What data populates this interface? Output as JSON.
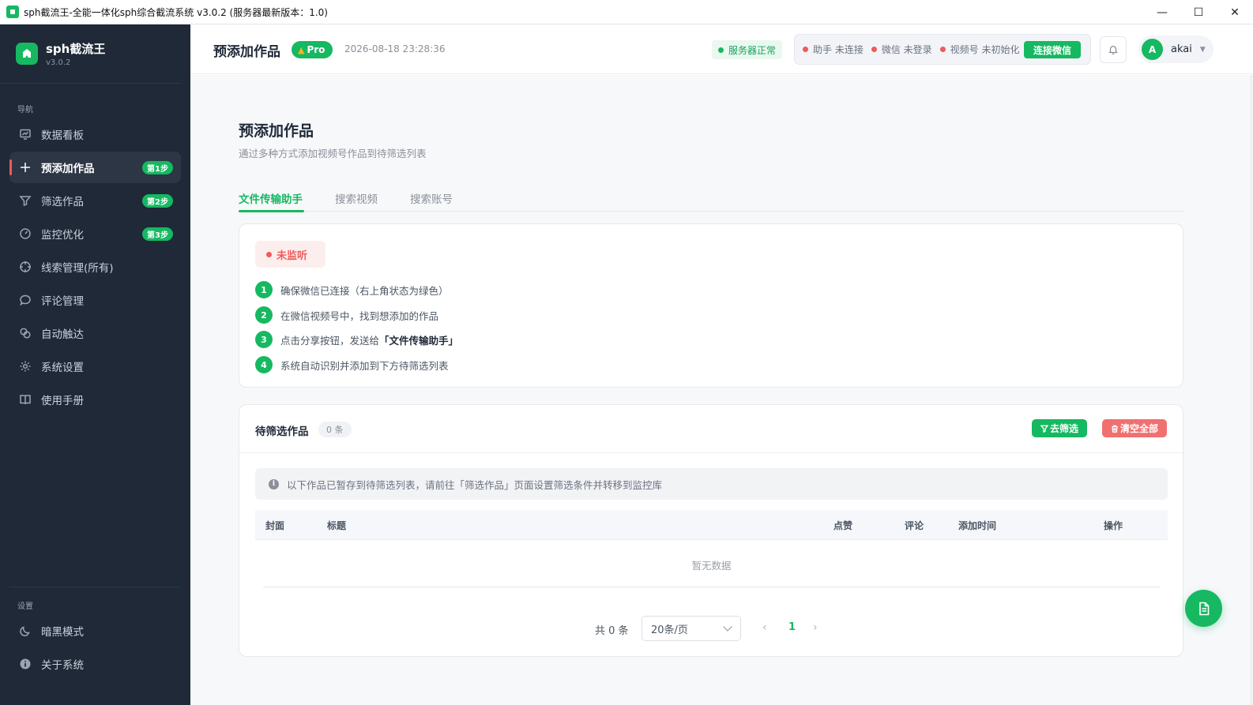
{
  "window": {
    "title": "sph截流王-全能一体化sph综合截流系统 v3.0.2 (服务器最新版本：1.0)",
    "controls": {
      "minimize": "—",
      "maximize": "☐",
      "close": "✕"
    }
  },
  "sidebar": {
    "brand_name": "sph截流王",
    "brand_version": "v3.0.2",
    "nav_section": "导航",
    "items": [
      {
        "label": "数据看板",
        "icon": "dashboard-icon"
      },
      {
        "label": "预添加作品",
        "icon": "plus-icon",
        "badge": "第1步",
        "active": true
      },
      {
        "label": "筛选作品",
        "icon": "filter-icon",
        "badge": "第2步"
      },
      {
        "label": "监控优化",
        "icon": "gauge-icon",
        "badge": "第3步"
      },
      {
        "label": "线索管理(所有)",
        "icon": "crosshair-icon"
      },
      {
        "label": "评论管理",
        "icon": "comment-icon"
      },
      {
        "label": "自动触达",
        "icon": "link-icon"
      },
      {
        "label": "系统设置",
        "icon": "gear-icon"
      },
      {
        "label": "使用手册",
        "icon": "book-icon"
      }
    ],
    "settings_section": "设置",
    "settings_items": [
      {
        "label": "暗黑模式",
        "icon": "moon-icon"
      },
      {
        "label": "关于系统",
        "icon": "info-icon"
      }
    ]
  },
  "header": {
    "title": "预添加作品",
    "pro_label": "Pro",
    "datetime": "2026-08-18 23:28:36",
    "server_status": "服务器正常",
    "connections": [
      {
        "label": "助手 未连接"
      },
      {
        "label": "微信 未登录"
      },
      {
        "label": "视频号 未初始化"
      }
    ],
    "connect_button": "连接微信",
    "user_initial": "A",
    "user_name": "akai"
  },
  "main": {
    "title": "预添加作品",
    "description": "通过多种方式添加视频号作品到待筛选列表",
    "tabs": [
      {
        "label": "文件传输助手",
        "active": true
      },
      {
        "label": "搜索视频"
      },
      {
        "label": "搜索账号"
      }
    ],
    "listen_status": "未监听",
    "steps": [
      {
        "num": "1",
        "text": "确保微信已连接（右上角状态为绿色）"
      },
      {
        "num": "2",
        "text": "在微信视频号中，找到想添加的作品"
      },
      {
        "num": "3",
        "text_before": "点击分享按钮，发送给",
        "text_em": "「文件传输助手」"
      },
      {
        "num": "4",
        "text": "系统自动识别并添加到下方待筛选列表"
      }
    ],
    "pending": {
      "title": "待筛选作品",
      "count": "0 条",
      "filter_button": "去筛选",
      "clear_button": "清空全部",
      "info": "以下作品已暂存到待筛选列表，请前往「筛选作品」页面设置筛选条件并转移到监控库",
      "columns": [
        "封面",
        "标题",
        "点赞",
        "评论",
        "添加时间",
        "操作"
      ],
      "empty_text": "暂无数据"
    },
    "pagination": {
      "total": "共 0 条",
      "page_size": "20条/页",
      "prev": "‹",
      "current": "1",
      "next": "›"
    }
  },
  "colors": {
    "accent": "#16b861",
    "danger": "#f05a5a",
    "sidebar_bg": "#1f2937"
  }
}
